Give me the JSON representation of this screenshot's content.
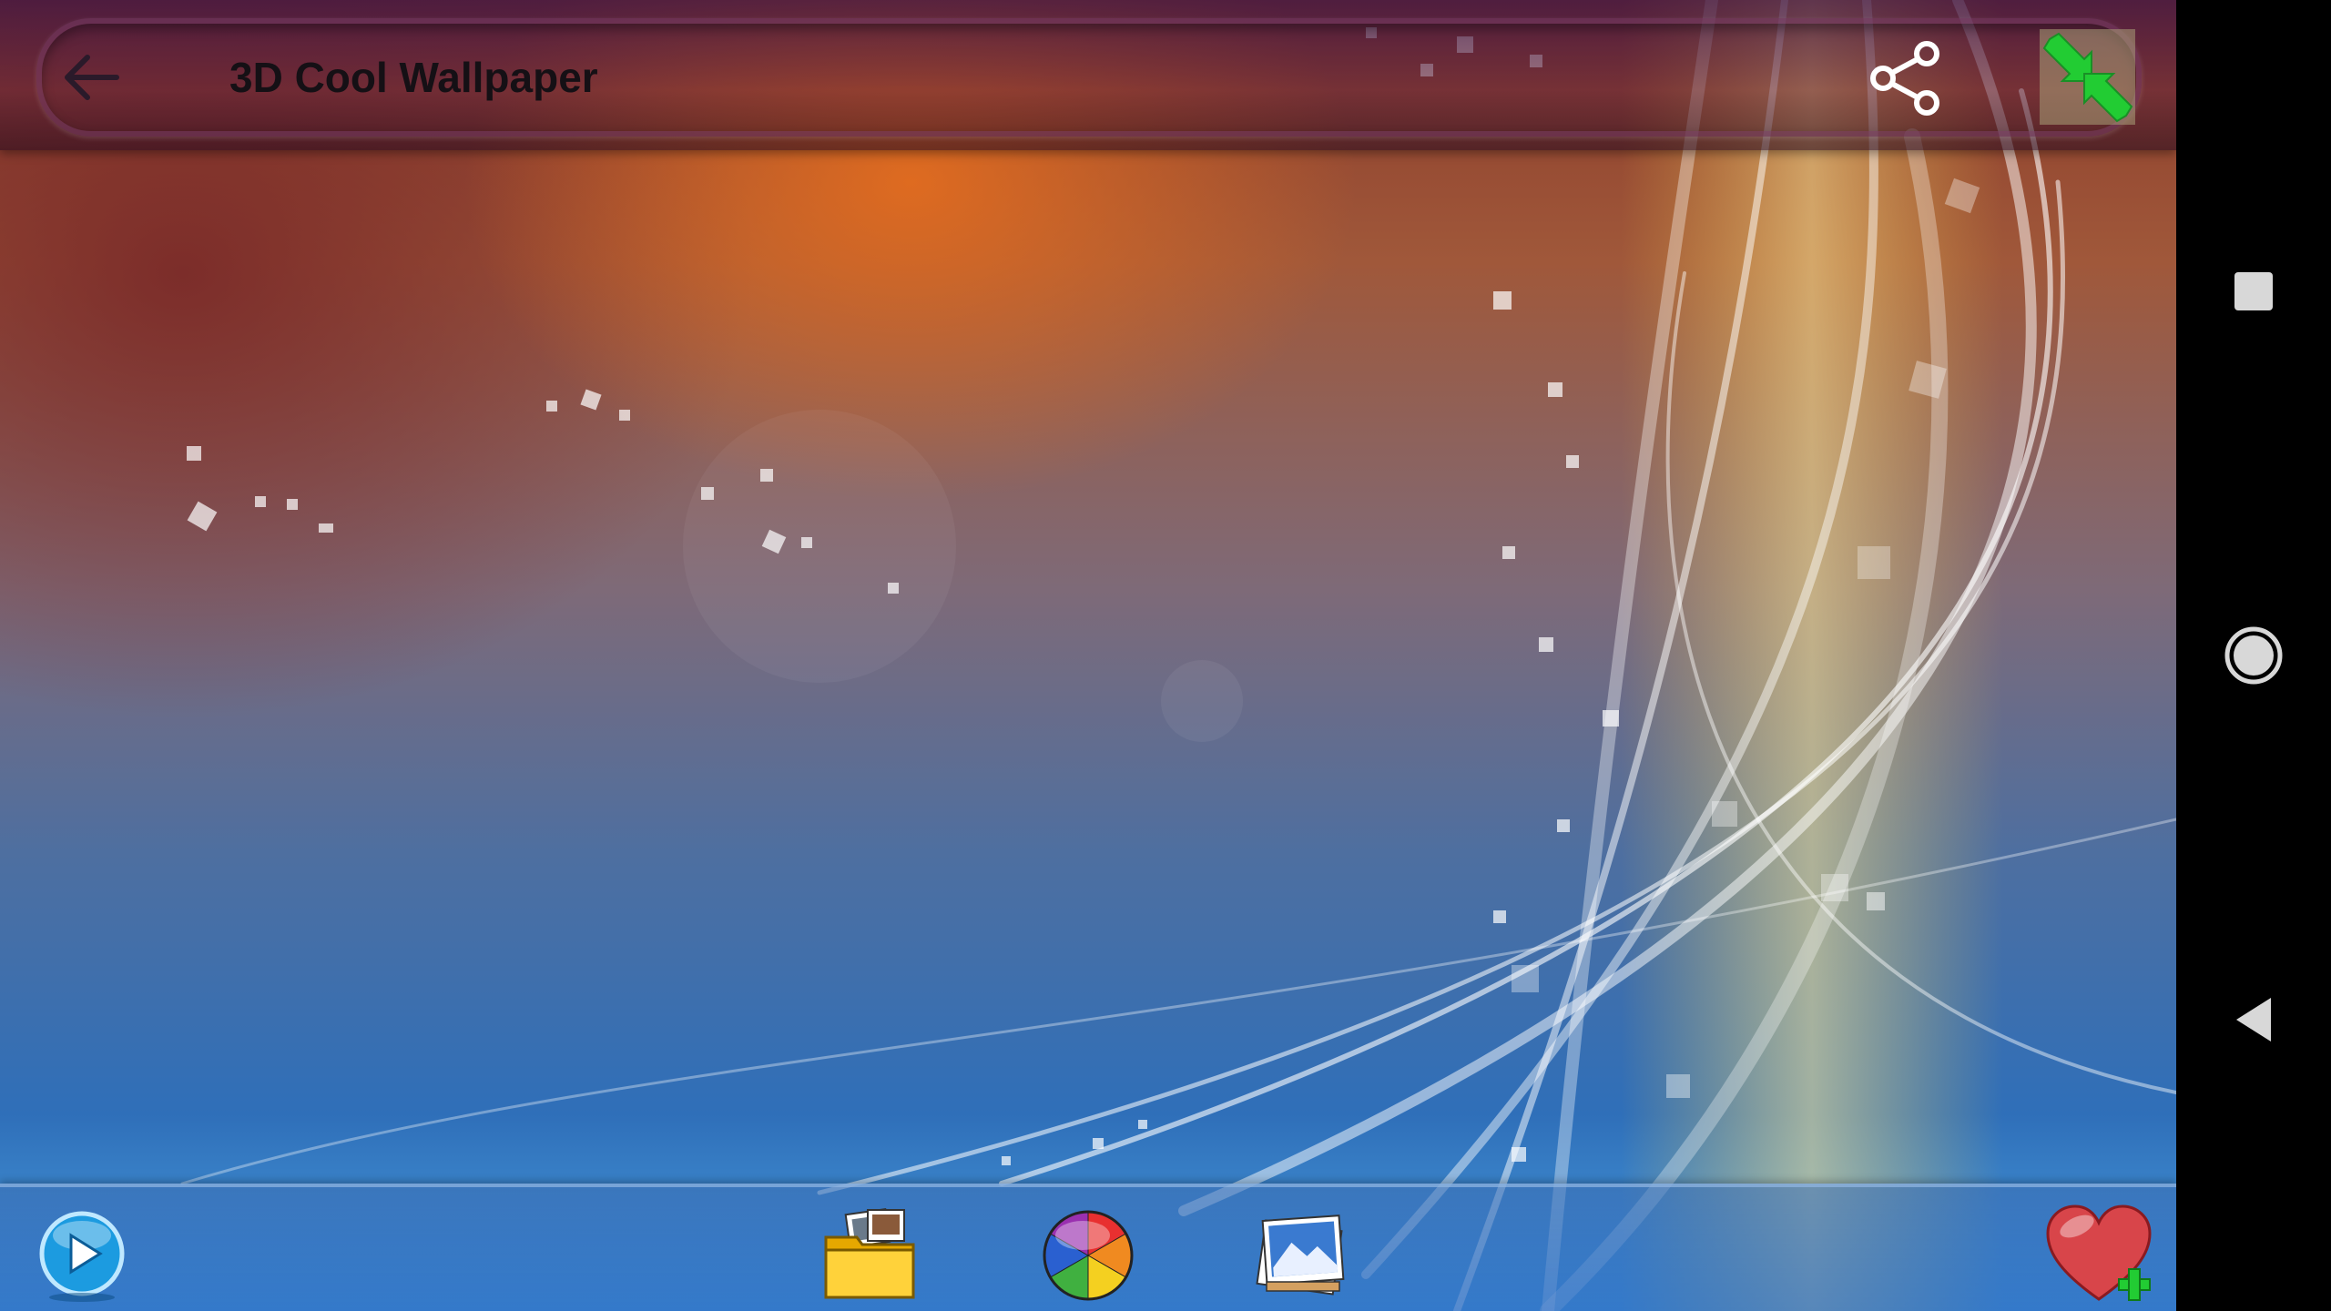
{
  "app": {
    "title": "3D Cool Wallpaper"
  },
  "top_bar": {
    "back_icon": "arrow-left-icon",
    "share_icon": "share-icon",
    "fullscreen_icon": "exit-fullscreen-icon"
  },
  "bottom_bar": {
    "items": [
      {
        "name": "play",
        "icon": "play-icon"
      },
      {
        "name": "folder",
        "icon": "folder-photos-icon"
      },
      {
        "name": "color",
        "icon": "color-wheel-icon"
      },
      {
        "name": "gallery",
        "icon": "photo-gallery-icon"
      },
      {
        "name": "favorite",
        "icon": "heart-plus-icon"
      }
    ]
  },
  "nav_bar": {
    "recents_icon": "square-icon",
    "home_icon": "circle-icon",
    "back_icon": "triangle-back-icon"
  },
  "colors": {
    "accent_green": "#22cc33",
    "heart_red": "#d8454a",
    "play_blue": "#1c9be0"
  }
}
